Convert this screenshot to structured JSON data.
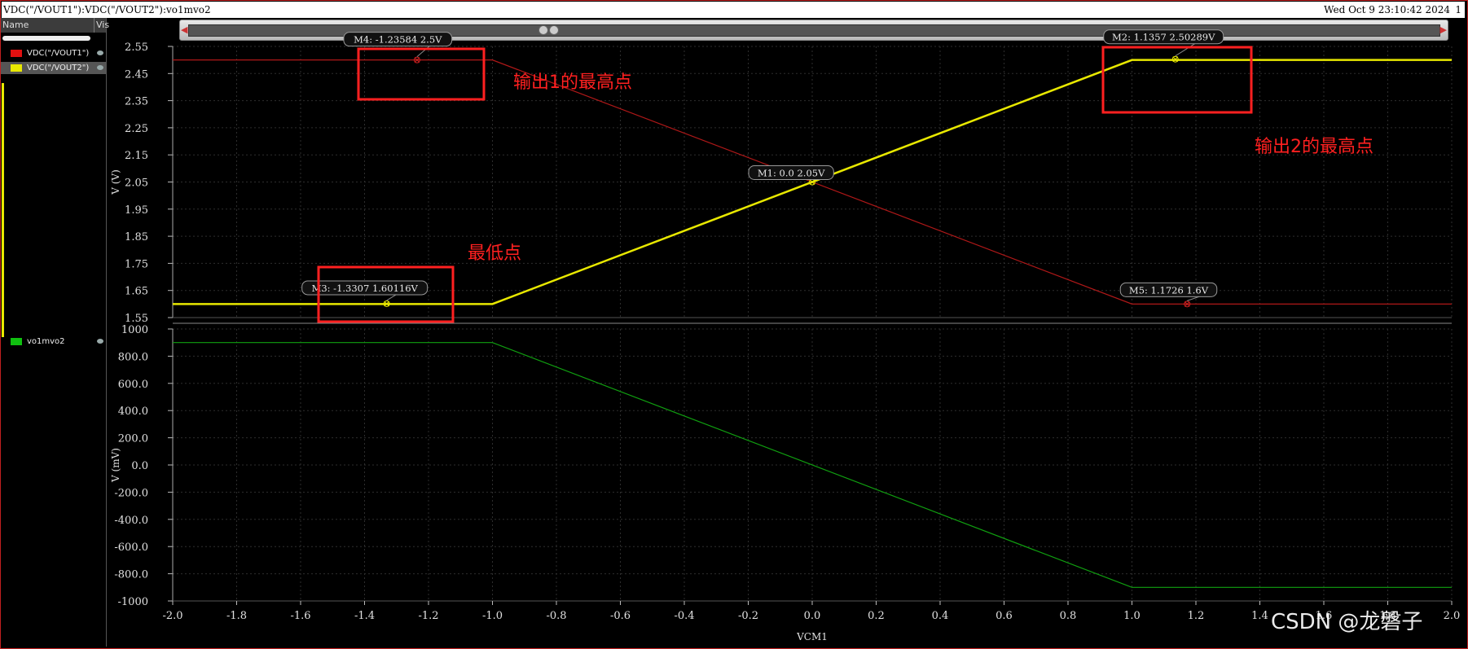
{
  "window": {
    "title": "VDC(\"/VOUT1\"):VDC(\"/VOUT2\"):vo1mvo2",
    "datetime": "Wed Oct 9 23:10:42 2024",
    "page": "1"
  },
  "sidebar": {
    "col_name": "Name",
    "col_vis": "Vis",
    "signals": [
      {
        "label": "VDC(\"/VOUT1\")",
        "color": "#e01010"
      },
      {
        "label": "VDC(\"/VOUT2\")",
        "color": "#e8e800"
      },
      {
        "label": "vo1mvo2",
        "color": "#10c010"
      }
    ]
  },
  "chart_data": [
    {
      "type": "line",
      "ylabel": "V (V)",
      "ylim": [
        1.55,
        2.55
      ],
      "yticks": [
        "2.55",
        "2.45",
        "2.35",
        "2.25",
        "2.15",
        "2.05",
        "1.95",
        "1.85",
        "1.75",
        "1.65",
        "1.55"
      ],
      "xlim": [
        -2.0,
        2.0
      ],
      "series": [
        {
          "name": "VDC(\"/VOUT1\")",
          "color": "#b01818",
          "x": [
            -2.0,
            -1.0,
            1.0,
            2.0
          ],
          "y": [
            2.5,
            2.5,
            1.6,
            1.6
          ]
        },
        {
          "name": "VDC(\"/VOUT2\")",
          "color": "#e8e800",
          "x": [
            -2.0,
            -1.0,
            1.0,
            2.0
          ],
          "y": [
            1.6,
            1.6,
            2.5,
            2.5
          ]
        }
      ],
      "markers": [
        {
          "id": "M4",
          "text": "M4: -1.23584 2.5V",
          "x": -1.23584,
          "y": 2.5,
          "color": "#d02020"
        },
        {
          "id": "M2",
          "text": "M2: 1.1357 2.50289V",
          "x": 1.1357,
          "y": 2.50289,
          "color": "#e8e800"
        },
        {
          "id": "M1",
          "text": "M1: 0.0 2.05V",
          "x": 0.0,
          "y": 2.05,
          "color": "#e8e800"
        },
        {
          "id": "M3",
          "text": "M3: -1.3307 1.60116V",
          "x": -1.3307,
          "y": 1.60116,
          "color": "#e8e800"
        },
        {
          "id": "M5",
          "text": "M5: 1.1726 1.6V",
          "x": 1.1726,
          "y": 1.6,
          "color": "#d02020"
        }
      ]
    },
    {
      "type": "line",
      "ylabel": "V (mV)",
      "ylim": [
        -1000,
        1000
      ],
      "yticks": [
        "1000",
        "800.0",
        "600.0",
        "400.0",
        "200.0",
        "0.0",
        "-200.0",
        "-400.0",
        "-600.0",
        "-800.0",
        "-1000"
      ],
      "xlim": [
        -2.0,
        2.0
      ],
      "xlabel": "VCM1",
      "xticks": [
        "-2.0",
        "-1.8",
        "-1.6",
        "-1.4",
        "-1.2",
        "-1.0",
        "-0.8",
        "-0.6",
        "-0.4",
        "-0.2",
        "0.0",
        "0.2",
        "0.4",
        "0.6",
        "0.8",
        "1.0",
        "1.2",
        "1.4",
        "1.6",
        "1.8",
        "2.0"
      ],
      "series": [
        {
          "name": "vo1mvo2",
          "color": "#10a010",
          "x": [
            -2.0,
            -1.0,
            1.0,
            2.0
          ],
          "y": [
            900,
            900,
            -900,
            -900
          ]
        }
      ]
    }
  ],
  "annotations": {
    "out1_peak": "输出1的最高点",
    "out2_peak": "输出2的最高点",
    "lowest": "最低点",
    "color": "#ff2020"
  },
  "watermark": "CSDN @龙磐子"
}
